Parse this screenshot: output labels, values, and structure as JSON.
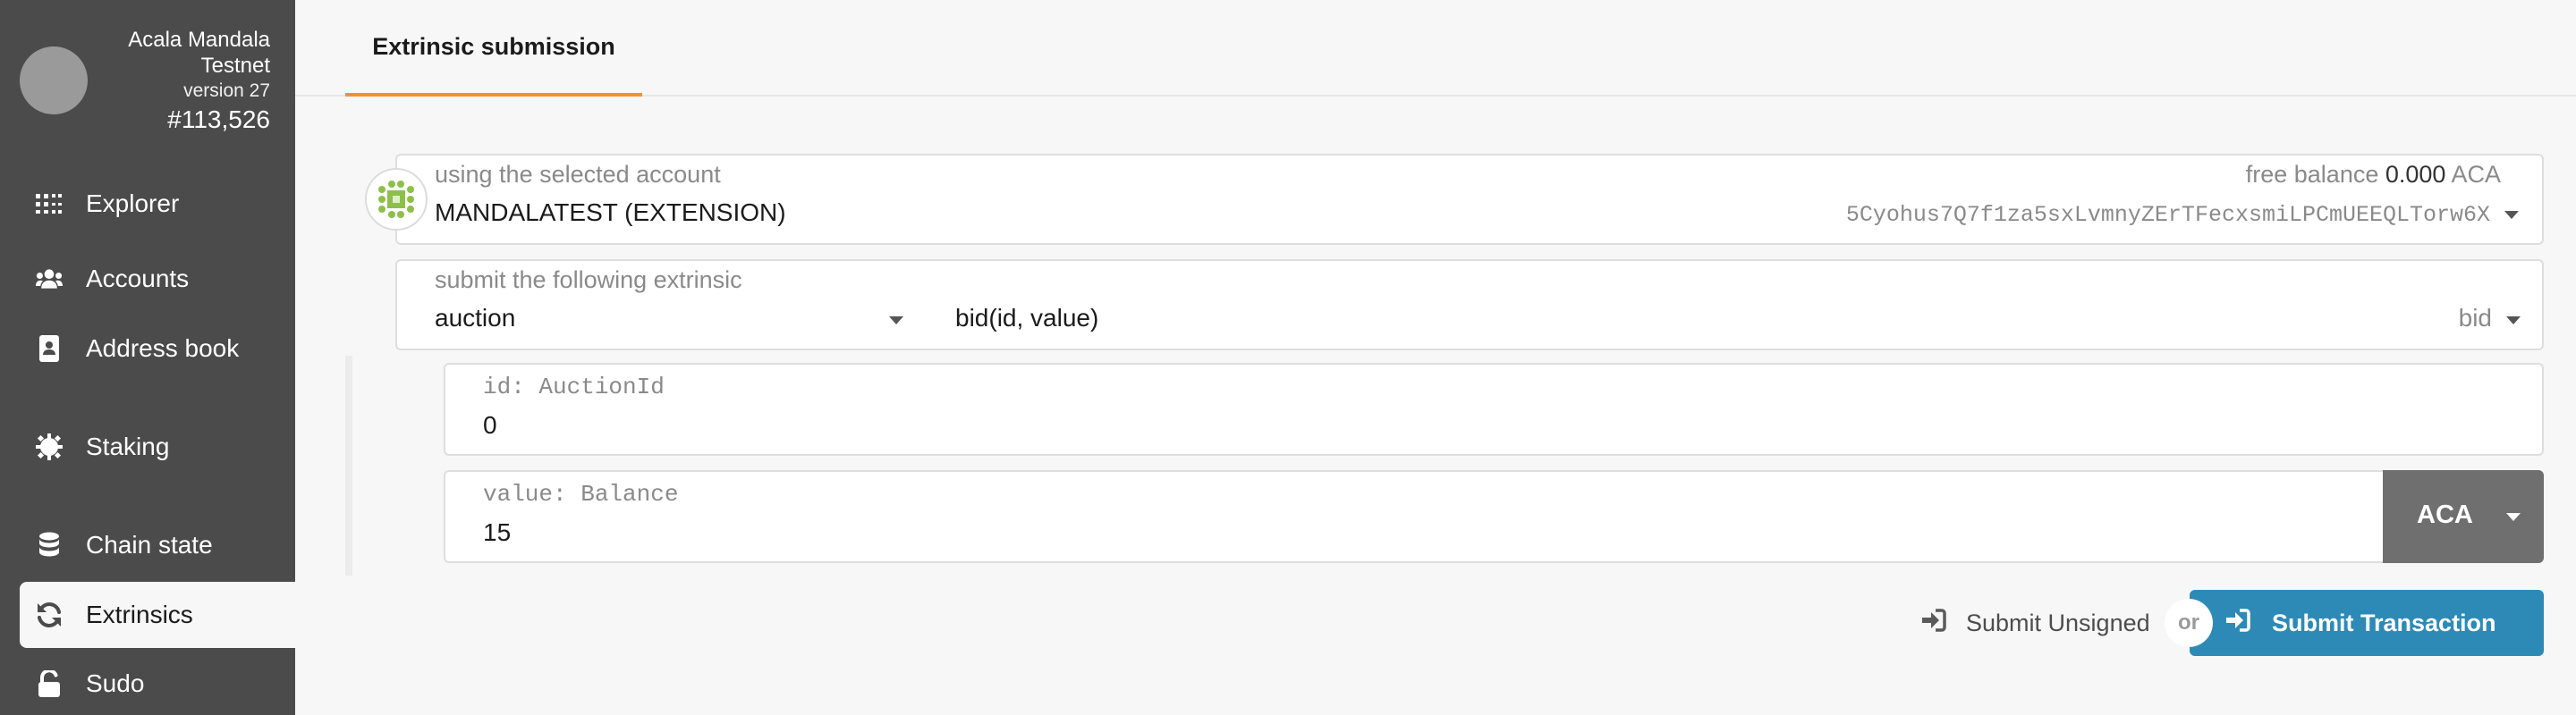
{
  "sidebar": {
    "chain_name": "Acala Mandala Testnet",
    "chain_version": "version 27",
    "chain_block": "#113,526",
    "items": [
      {
        "label": "Explorer",
        "icon": "explorer-icon"
      },
      {
        "label": "Accounts",
        "icon": "users-icon"
      },
      {
        "label": "Address book",
        "icon": "address-book-icon"
      },
      {
        "label": "Staking",
        "icon": "staking-icon"
      },
      {
        "label": "Chain state",
        "icon": "database-icon"
      },
      {
        "label": "Extrinsics",
        "icon": "sync-icon",
        "active": true
      },
      {
        "label": "Sudo",
        "icon": "unlock-icon"
      }
    ]
  },
  "tabs": [
    {
      "label": "Extrinsic submission",
      "active": true
    }
  ],
  "account": {
    "label": "using the selected account",
    "name": "MANDALATEST (EXTENSION)",
    "balance_label": "free balance",
    "balance_value": "0.000",
    "balance_unit": "ACA",
    "address": "5Cyohus7Q7f1za5sxLvmnyZErTFecxsmiLPCmUEEQLTorw6X"
  },
  "extrinsic": {
    "label": "submit the following extrinsic",
    "module": "auction",
    "call_signature": "bid(id, value)",
    "method": "bid"
  },
  "params": [
    {
      "label": "id: AuctionId",
      "value": "0"
    },
    {
      "label": "value: Balance",
      "value": "15",
      "currency": "ACA"
    }
  ],
  "actions": {
    "unsigned_label": "Submit Unsigned",
    "or_label": "or",
    "submit_label": "Submit Transaction"
  },
  "colors": {
    "sidebar_bg": "#4b4b4b",
    "tab_accent": "#f19135",
    "submit_bg": "#2d8ab6",
    "currency_bg": "#6f6f6f"
  }
}
